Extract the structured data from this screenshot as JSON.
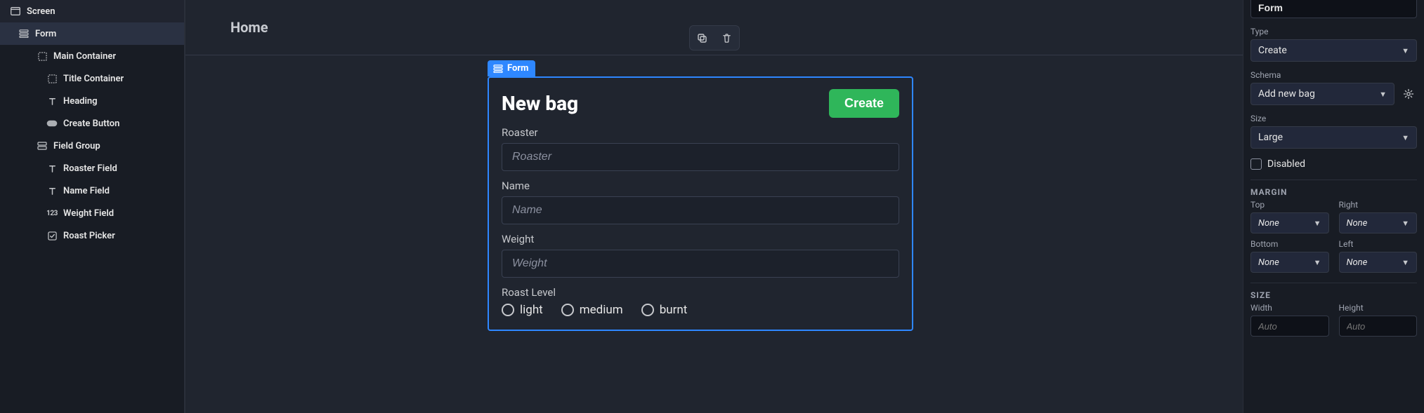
{
  "tree": {
    "items": [
      {
        "label": "Screen",
        "depth": 0,
        "icon": "window-icon",
        "selected": false
      },
      {
        "label": "Form",
        "depth": 1,
        "icon": "form-icon",
        "selected": true
      },
      {
        "label": "Main Container",
        "depth": 2,
        "icon": "container-icon",
        "selected": false
      },
      {
        "label": "Title Container",
        "depth": 3,
        "icon": "container-icon",
        "selected": false
      },
      {
        "label": "Heading",
        "depth": 3,
        "icon": "text-icon",
        "selected": false
      },
      {
        "label": "Create Button",
        "depth": 3,
        "icon": "button-icon",
        "selected": false
      },
      {
        "label": "Field Group",
        "depth": 2,
        "icon": "group-icon",
        "selected": false
      },
      {
        "label": "Roaster Field",
        "depth": 3,
        "icon": "text-icon",
        "selected": false
      },
      {
        "label": "Name Field",
        "depth": 3,
        "icon": "text-icon",
        "selected": false
      },
      {
        "label": "Weight Field",
        "depth": 3,
        "icon": "number-icon",
        "selected": false
      },
      {
        "label": "Roast Picker",
        "depth": 3,
        "icon": "options-icon",
        "selected": false
      }
    ]
  },
  "crumb": {
    "label": "Home"
  },
  "selection_tag": {
    "label": "Form"
  },
  "form": {
    "title": "New bag",
    "create_button": "Create",
    "fields": {
      "roaster": {
        "label": "Roaster",
        "placeholder": "Roaster"
      },
      "name": {
        "label": "Name",
        "placeholder": "Name"
      },
      "weight": {
        "label": "Weight",
        "placeholder": "Weight"
      }
    },
    "roast": {
      "label": "Roast Level",
      "options": [
        "light",
        "medium",
        "burnt"
      ]
    }
  },
  "inspector": {
    "name_value": "Form",
    "type": {
      "label": "Type",
      "value": "Create"
    },
    "schema": {
      "label": "Schema",
      "value": "Add new bag"
    },
    "size": {
      "label": "Size",
      "value": "Large"
    },
    "disabled_label": "Disabled",
    "margin": {
      "section": "MARGIN",
      "top": {
        "label": "Top",
        "value": "None"
      },
      "right": {
        "label": "Right",
        "value": "None"
      },
      "bottom": {
        "label": "Bottom",
        "value": "None"
      },
      "left": {
        "label": "Left",
        "value": "None"
      }
    },
    "size_section": {
      "section": "SIZE",
      "width": {
        "label": "Width",
        "value": "Auto"
      },
      "height": {
        "label": "Height",
        "value": "Auto"
      }
    }
  }
}
